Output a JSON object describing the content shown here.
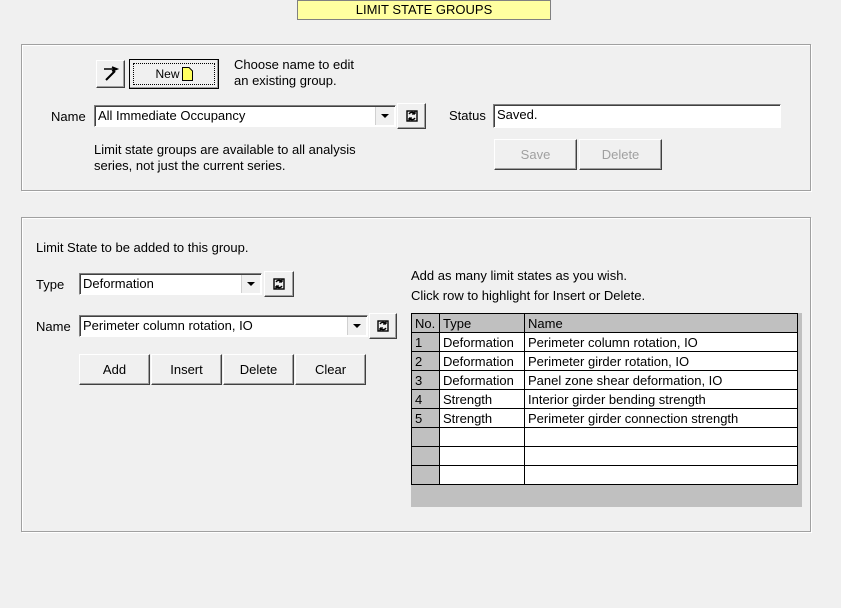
{
  "header": {
    "title": "LIMIT STATE GROUPS"
  },
  "group_panel": {
    "new_button_label": "New",
    "hint_line1": "Choose name to edit",
    "hint_line2": "an existing group.",
    "name_label": "Name",
    "name_value": "All Immediate Occupancy",
    "availability_line1": "Limit state groups are available to all analysis",
    "availability_line2": "series, not just the current series.",
    "status_label": "Status",
    "status_value": "Saved.",
    "save_label": "Save",
    "delete_label": "Delete"
  },
  "limit_state_panel": {
    "intro": "Limit State to be added to this group.",
    "type_label": "Type",
    "type_value": "Deformation",
    "name_label": "Name",
    "name_value": "Perimeter column rotation, IO",
    "buttons": {
      "add": "Add",
      "insert": "Insert",
      "delete": "Delete",
      "clear": "Clear"
    },
    "instructions_line1": "Add as many limit states as you wish.",
    "instructions_line2": "Click row to highlight for Insert or Delete."
  },
  "table": {
    "headers": [
      "No.",
      "Type",
      "Name"
    ],
    "rows": [
      [
        "1",
        "Deformation",
        "Perimeter column rotation, IO"
      ],
      [
        "2",
        "Deformation",
        "Perimeter girder rotation, IO"
      ],
      [
        "3",
        "Deformation",
        "Panel zone shear deformation, IO"
      ],
      [
        "4",
        "Strength",
        "Interior girder bending strength"
      ],
      [
        "5",
        "Strength",
        "Perimeter girder connection strength"
      ],
      [
        "",
        "",
        ""
      ],
      [
        "",
        "",
        ""
      ],
      [
        "",
        "",
        ""
      ]
    ]
  }
}
